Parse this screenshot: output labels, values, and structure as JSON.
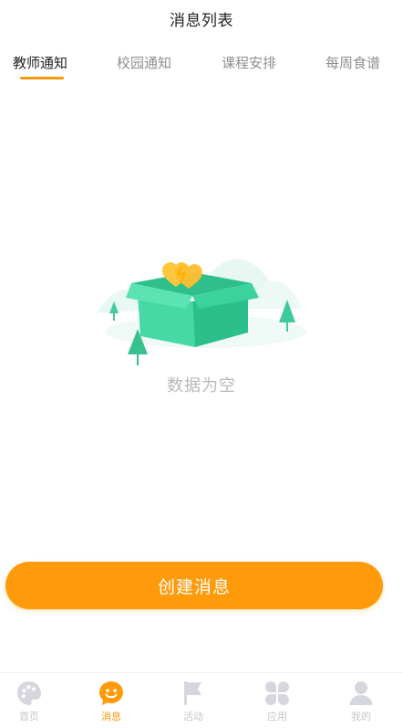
{
  "header": {
    "title": "消息列表"
  },
  "tabs": [
    {
      "label": "教师通知",
      "active": true
    },
    {
      "label": "校园通知",
      "active": false
    },
    {
      "label": "课程安排",
      "active": false
    },
    {
      "label": "每周食谱",
      "active": false
    }
  ],
  "empty_state": {
    "icon": "empty-box-icon",
    "text": "数据为空"
  },
  "actions": {
    "create_label": "创建消息"
  },
  "bottom_nav": [
    {
      "label": "首页",
      "icon": "palette-icon",
      "active": false
    },
    {
      "label": "消息",
      "icon": "smile-chat-icon",
      "active": true
    },
    {
      "label": "活动",
      "icon": "flag-icon",
      "active": false
    },
    {
      "label": "应用",
      "icon": "clover-grid-icon",
      "active": false
    },
    {
      "label": "我的",
      "icon": "user-icon",
      "active": false
    }
  ],
  "colors": {
    "accent": "#ff9a0a",
    "tab_underline": "#f39c12",
    "nav_inactive": "#c7c7c7",
    "box_green": "#3fd3a0",
    "heart_yellow": "#ffc73d"
  }
}
